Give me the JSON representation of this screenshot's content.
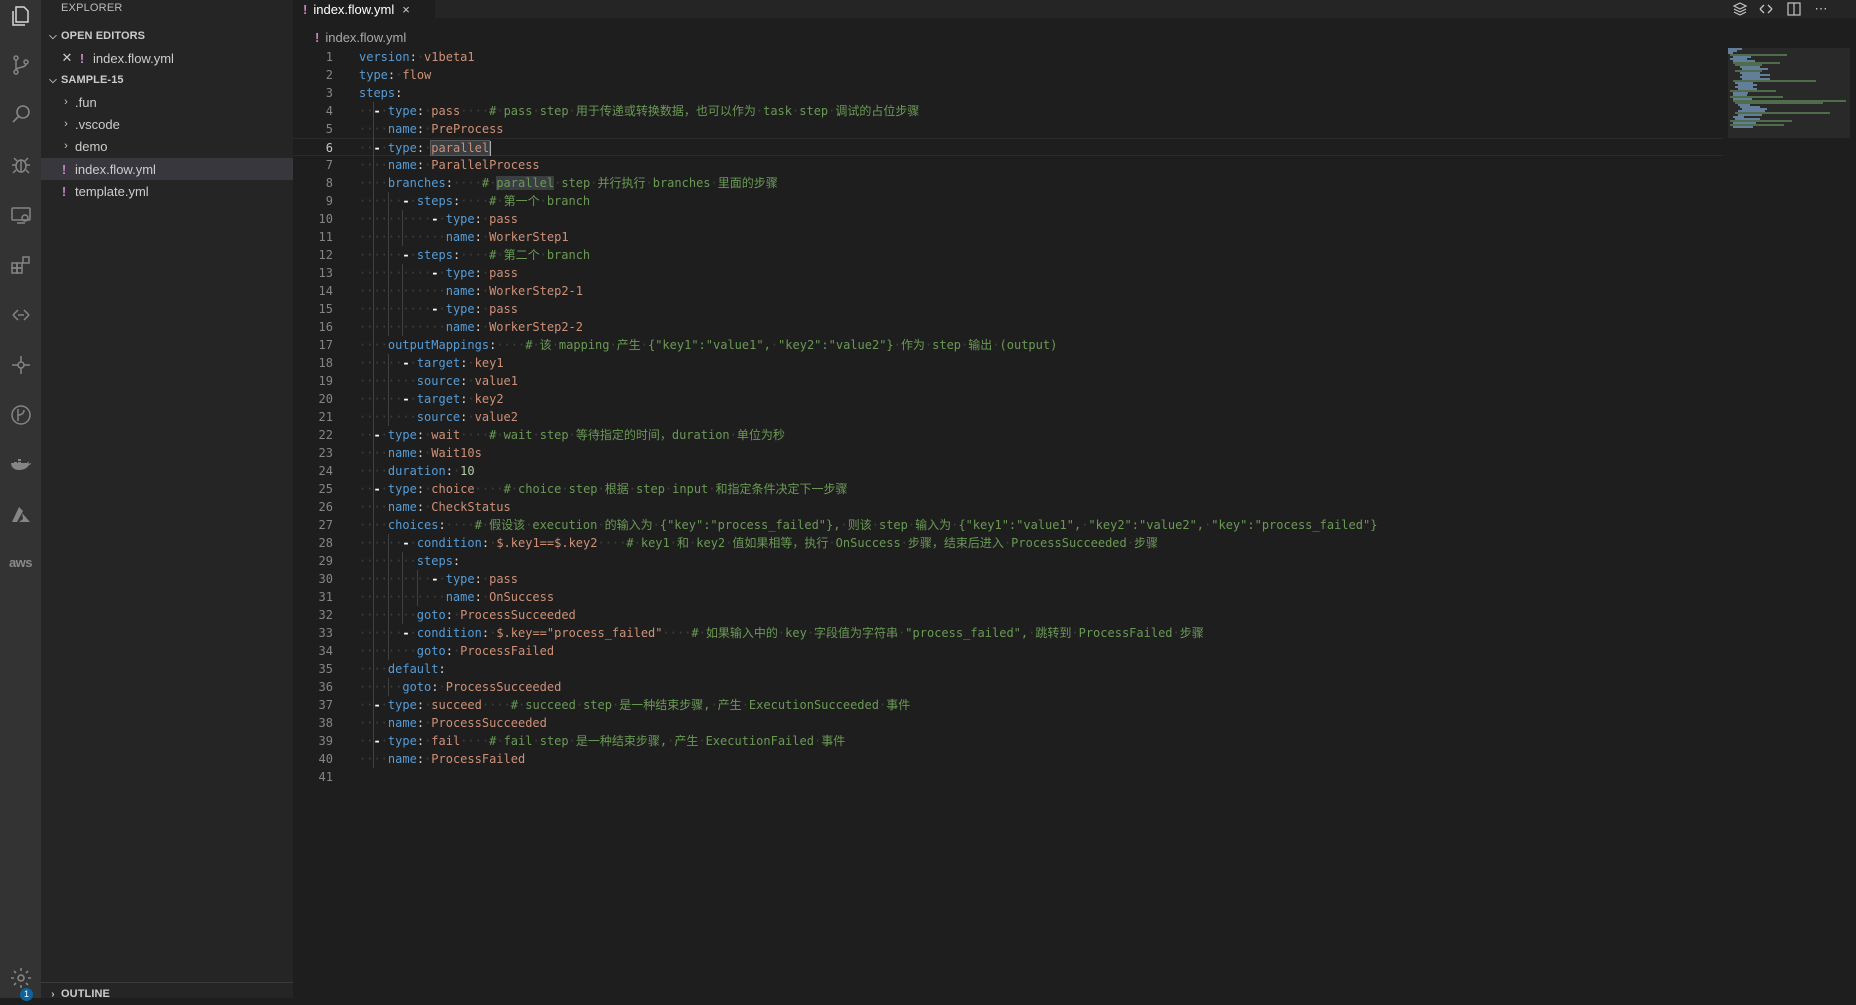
{
  "activity_bar": {
    "icons": [
      "explorer-icon",
      "source-control-icon",
      "search-icon",
      "debug-icon",
      "remote-explorer-icon",
      "extensions-icon",
      "serverless-icon",
      "function-compute-icon",
      "git-graph-icon",
      "docker-icon",
      "azure-icon",
      "aws-icon"
    ],
    "aws_label": "aws",
    "settings_badge": "1"
  },
  "sidebar": {
    "title": "EXPLORER",
    "open_editors_label": "OPEN EDITORS",
    "open_editor_file": "index.flow.yml",
    "workspace_label": "SAMPLE-15",
    "tree": [
      {
        "label": ".fun",
        "type": "folder"
      },
      {
        "label": ".vscode",
        "type": "folder"
      },
      {
        "label": "demo",
        "type": "folder"
      },
      {
        "label": "index.flow.yml",
        "type": "file",
        "active": true
      },
      {
        "label": "template.yml",
        "type": "file"
      }
    ],
    "outline_label": "OUTLINE"
  },
  "tab": {
    "label": "index.flow.yml",
    "yml_marker": "!",
    "close": "×"
  },
  "breadcrumb": {
    "file": "index.flow.yml"
  },
  "editor": {
    "line_numbers": [
      "1",
      "2",
      "3",
      "4",
      "5",
      "6",
      "7",
      "8",
      "9",
      "10",
      "11",
      "12",
      "13",
      "14",
      "15",
      "16",
      "17",
      "18",
      "19",
      "20",
      "21",
      "22",
      "23",
      "24",
      "25",
      "26",
      "27",
      "28",
      "29",
      "30",
      "31",
      "32",
      "33",
      "34",
      "35",
      "36",
      "37",
      "38",
      "39",
      "40",
      "41"
    ],
    "current_line": "6",
    "code": [
      "version: v1beta1",
      "type: flow",
      "steps:",
      "  - type: pass    # pass step 用于传递或转换数据，也可以作为 task step 调试的占位步骤",
      "    name: PreProcess",
      "  - type: parallel",
      "    name: ParallelProcess",
      "    branches:    # parallel step 并行执行 branches 里面的步骤",
      "      - steps:    # 第一个 branch",
      "          - type: pass",
      "            name: WorkerStep1",
      "      - steps:    # 第二个 branch",
      "          - type: pass",
      "            name: WorkerStep2-1",
      "          - type: pass",
      "            name: WorkerStep2-2",
      "    outputMappings:    # 该 mapping 产生 {\"key1\":\"value1\", \"key2\":\"value2\"} 作为 step 输出 (output)",
      "      - target: key1",
      "        source: value1",
      "      - target: key2",
      "        source: value2",
      "  - type: wait    # wait step 等待指定的时间，duration 单位为秒",
      "    name: Wait10s",
      "    duration: 10",
      "  - type: choice    # choice step 根据 step input 和指定条件决定下一步骤",
      "    name: CheckStatus",
      "    choices:    # 假设该 execution 的输入为 {\"key\":\"process_failed\"}, 则该 step 输入为 {\"key1\":\"value1\", \"key2\":\"value2\", \"key\":\"process_failed\"}",
      "      - condition: $.key1==$.key2    # key1 和 key2 值如果相等，执行 OnSuccess 步骤，结束后进入 ProcessSucceeded 步骤",
      "        steps:",
      "          - type: pass",
      "            name: OnSuccess",
      "        goto: ProcessSucceeded",
      "      - condition: $.key==\"process_failed\"    # 如果输入中的 key 字段值为字符串 \"process_failed\", 跳转到 ProcessFailed 步骤",
      "        goto: ProcessFailed",
      "    default:",
      "      goto: ProcessSucceeded",
      "  - type: succeed    # succeed step 是一种结束步骤, 产生 ExecutionSucceeded 事件",
      "    name: ProcessSucceeded",
      "  - type: fail    # fail step 是一种结束步骤, 产生 ExecutionFailed 事件",
      "    name: ProcessFailed",
      ""
    ]
  },
  "colors": {
    "key": "#569cd6",
    "string": "#ce9178",
    "number": "#b5cea8",
    "comment": "#6a9955",
    "yml_marker": "#c586c0",
    "editor_bg": "#1e1e1e",
    "sidebar_bg": "#252526",
    "activity_bg": "#333333"
  }
}
